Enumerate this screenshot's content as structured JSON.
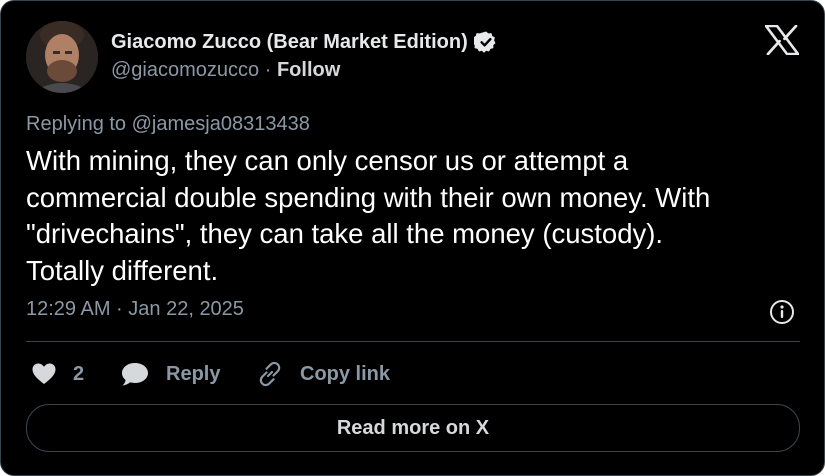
{
  "author": {
    "name": "Giacomo Zucco (Bear Market Edition)",
    "handle": "@giacomozucco",
    "separator": "·",
    "follow_label": "Follow"
  },
  "tweet": {
    "reply_to": "Replying to @jamesja08313438",
    "text_lines": [
      "With mining, they can only censor us or attempt a",
      "commercial double spending with their own money. With",
      "\"drivechains\", they can take all the money (custody).",
      "Totally different."
    ],
    "timestamp": "12:29 AM · Jan 22, 2025"
  },
  "actions": {
    "like_count": "2",
    "reply_label": "Reply",
    "copy_label": "Copy link",
    "read_more_label": "Read more on X"
  },
  "icons": {
    "avatar": "avatar-photo",
    "verified": "verified-badge-icon",
    "logo": "x-logo-icon",
    "info": "info-icon",
    "like": "heart-icon",
    "reply": "speech-bubble-icon",
    "copy": "link-icon"
  },
  "colors": {
    "background": "#000000",
    "text": "#e7e9ea",
    "secondary_text": "#8b98a5",
    "border": "#38444d"
  }
}
